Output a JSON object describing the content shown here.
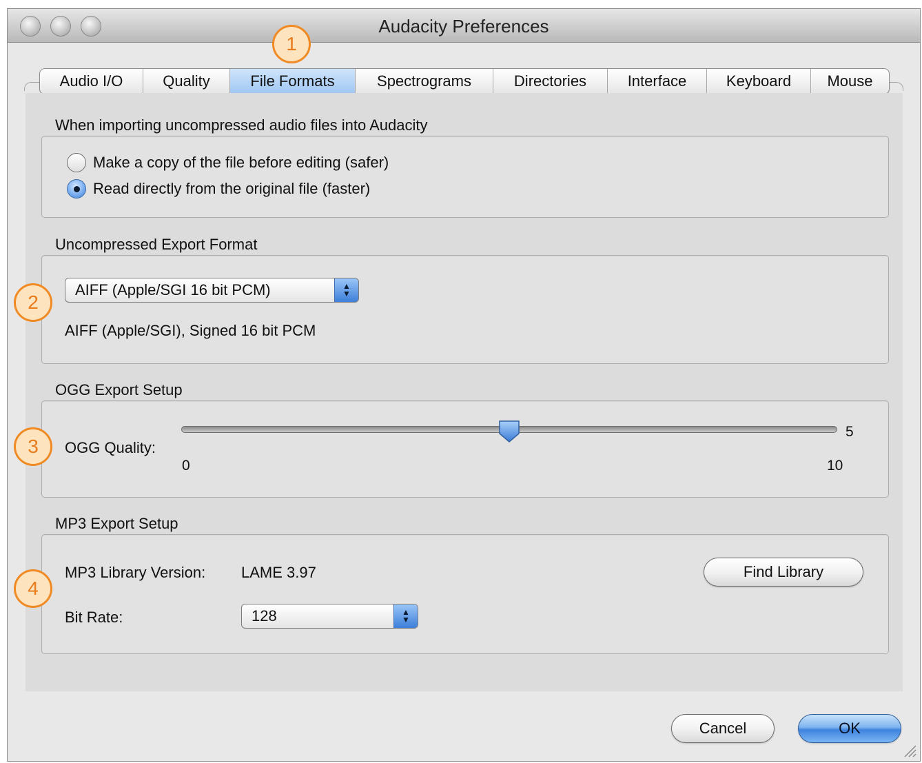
{
  "window": {
    "title": "Audacity Preferences"
  },
  "tabs": [
    {
      "label": "Audio I/O",
      "active": false
    },
    {
      "label": "Quality",
      "active": false
    },
    {
      "label": "File Formats",
      "active": true
    },
    {
      "label": "Spectrograms",
      "active": false
    },
    {
      "label": "Directories",
      "active": false
    },
    {
      "label": "Interface",
      "active": false
    },
    {
      "label": "Keyboard",
      "active": false
    },
    {
      "label": "Mouse",
      "active": false
    }
  ],
  "import_section": {
    "label": "When importing uncompressed audio files into Audacity",
    "options": [
      {
        "label": "Make a copy of the file before editing (safer)",
        "selected": false
      },
      {
        "label": "Read directly from the original file (faster)",
        "selected": true
      }
    ]
  },
  "export_format_section": {
    "label": "Uncompressed Export Format",
    "selected": "AIFF (Apple/SGI 16 bit PCM)",
    "description": "AIFF (Apple/SGI), Signed 16 bit PCM"
  },
  "ogg_section": {
    "label": "OGG Export Setup",
    "quality_label": "OGG Quality:",
    "value": "5",
    "min": "0",
    "max": "10"
  },
  "mp3_section": {
    "label": "MP3 Export Setup",
    "library_version_label": "MP3 Library Version:",
    "library_version": "LAME 3.97",
    "find_library_label": "Find Library",
    "bit_rate_label": "Bit Rate:",
    "bit_rate": "128"
  },
  "footer": {
    "cancel_label": "Cancel",
    "ok_label": "OK"
  },
  "badges": [
    "1",
    "2",
    "3",
    "4"
  ],
  "colors": {
    "accent": "#3f83df",
    "badge_border": "#f08a24",
    "badge_fill": "#fde4bf"
  }
}
